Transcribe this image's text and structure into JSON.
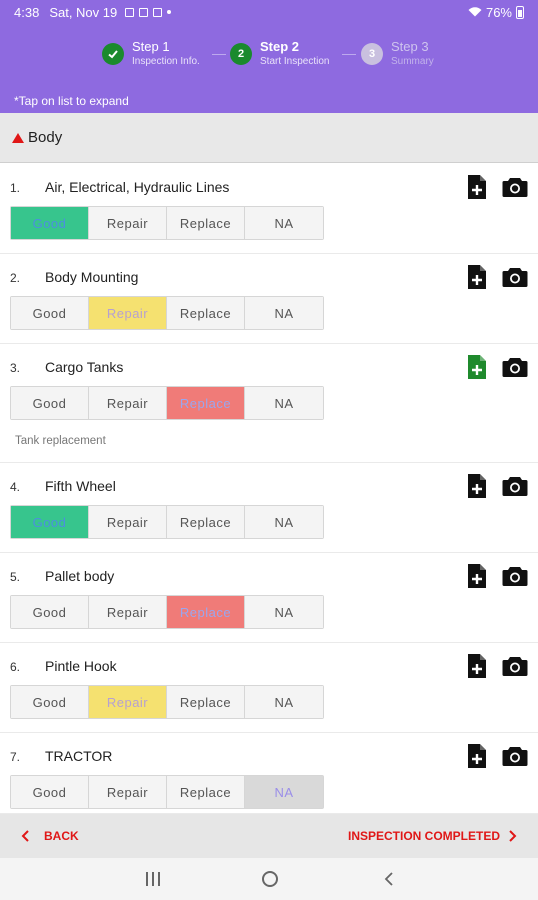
{
  "status": {
    "time": "4:38",
    "date": "Sat, Nov 19",
    "battery": "76%"
  },
  "stepper": [
    {
      "title": "Step 1",
      "subtitle": "Inspection Info.",
      "state": "done",
      "badge": ""
    },
    {
      "title": "Step 2",
      "subtitle": "Start Inspection",
      "state": "active",
      "badge": "2"
    },
    {
      "title": "Step 3",
      "subtitle": "Summary",
      "state": "future",
      "badge": "3"
    }
  ],
  "hint": "*Tap on list to expand",
  "section": {
    "title": "Body"
  },
  "options": [
    "Good",
    "Repair",
    "Replace",
    "NA"
  ],
  "items": [
    {
      "num": "1.",
      "name": "Air, Electrical, Hydraulic Lines",
      "selected": "Good",
      "note": "",
      "note_icon_color": "#111111"
    },
    {
      "num": "2.",
      "name": "Body Mounting",
      "selected": "Repair",
      "note": "",
      "note_icon_color": "#111111"
    },
    {
      "num": "3.",
      "name": "Cargo Tanks",
      "selected": "Replace",
      "note": "Tank replacement",
      "note_icon_color": "#1f8a2d"
    },
    {
      "num": "4.",
      "name": "Fifth Wheel",
      "selected": "Good",
      "note": "",
      "note_icon_color": "#111111"
    },
    {
      "num": "5.",
      "name": "Pallet body",
      "selected": "Replace",
      "note": "",
      "note_icon_color": "#111111"
    },
    {
      "num": "6.",
      "name": "Pintle Hook",
      "selected": "Repair",
      "note": "",
      "note_icon_color": "#111111"
    },
    {
      "num": "7.",
      "name": "TRACTOR",
      "selected": "NA",
      "note": "",
      "note_icon_color": "#111111"
    }
  ],
  "footer": {
    "back_label": "BACK",
    "complete_label": "INSPECTION COMPLETED"
  },
  "colors": {
    "header": "#8e6ae0",
    "accent_red": "#e01717",
    "good": "#37c58d",
    "repair": "#f5e170",
    "replace": "#f07b78",
    "na": "#d9d9d9"
  }
}
